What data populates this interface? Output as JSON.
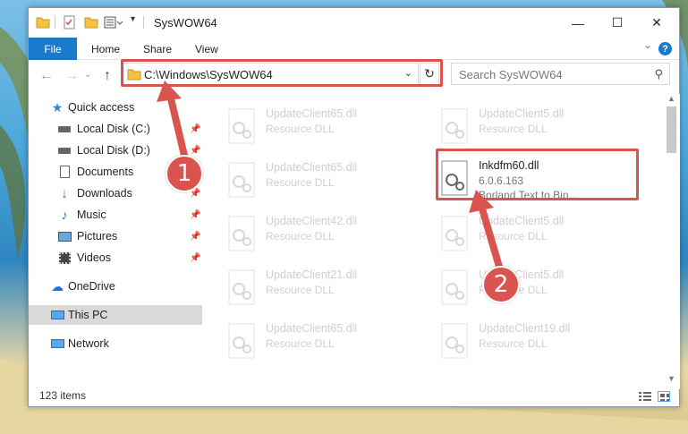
{
  "window": {
    "title": "SysWOW64",
    "minimize_glyph": "—",
    "maximize_glyph": "☐",
    "close_glyph": "✕"
  },
  "ribbon": {
    "file": "File",
    "tabs": [
      "Home",
      "Share",
      "View"
    ],
    "expand_glyph": "⌄",
    "help": "?"
  },
  "address": {
    "path": "C:\\Windows\\SysWOW64",
    "search_placeholder": "Search SysWOW64"
  },
  "sidebar": {
    "items": [
      {
        "label": "Quick access",
        "icon": "star-icon"
      },
      {
        "label": "Local Disk (C:)",
        "icon": "drive-icon"
      },
      {
        "label": "Local Disk (D:)",
        "icon": "drive-icon"
      },
      {
        "label": "Documents",
        "icon": "documents-icon"
      },
      {
        "label": "Downloads",
        "icon": "download-icon"
      },
      {
        "label": "Music",
        "icon": "music-icon"
      },
      {
        "label": "Pictures",
        "icon": "pictures-icon"
      },
      {
        "label": "Videos",
        "icon": "videos-icon"
      },
      {
        "label": "OneDrive",
        "icon": "cloud-icon"
      },
      {
        "label": "This PC",
        "icon": "computer-icon"
      },
      {
        "label": "Network",
        "icon": "network-icon"
      }
    ]
  },
  "files": {
    "col1": [
      {
        "name": "UpdateClient65.dll",
        "type": "Resource DLL"
      },
      {
        "name": "UpdateClient65.dll",
        "type": "Resource DLL"
      },
      {
        "name": "UpdateClient42.dll",
        "type": "Resource DLL"
      },
      {
        "name": "UpdateClient21.dll",
        "type": "Resource DLL"
      },
      {
        "name": "UpdateClient65.dll",
        "type": "Resource DLL"
      }
    ],
    "col2": [
      {
        "name": "UpdateClient5.dll",
        "type": "Resource DLL"
      },
      {
        "name": "UpdateClient5.dll",
        "type": "Resource DLL"
      },
      {
        "name": "UpdateClient5.dll",
        "type": "Resource DLL"
      },
      {
        "name": "UpdateClient19.dll",
        "type": "Resource DLL"
      }
    ],
    "selected": {
      "name": "Inkdfm60.dll",
      "version": "6.0.6.163",
      "description": "Borland Text to Bin..."
    }
  },
  "status": {
    "items_count": "123 items"
  },
  "annotations": {
    "badge1": "1",
    "badge2": "2",
    "accent": "#d9534f"
  }
}
